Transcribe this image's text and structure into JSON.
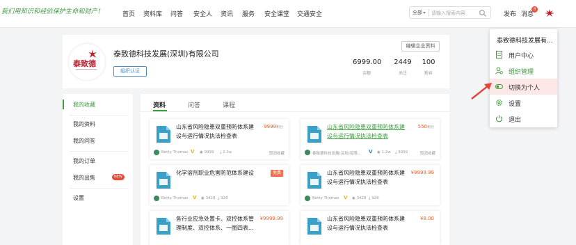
{
  "header": {
    "slogan": "我们用知识和经验保护生命和财产！",
    "nav": [
      "首页",
      "资料库",
      "问答",
      "安全人",
      "资讯",
      "服务",
      "安全课堂",
      "交通安全"
    ],
    "search": {
      "scope": "全部",
      "placeholder": "请输入搜索内容"
    },
    "publish_label": "发布",
    "messages_label": "消息",
    "messages_count": "8"
  },
  "profile": {
    "logo_text": "泰致德",
    "company_name": "泰致德科技发展(深圳)有限公司",
    "org_button": "组织认证",
    "edit_button": "编辑企业资料",
    "stats": [
      {
        "value": "6999.00",
        "label": "余额"
      },
      {
        "value": "2449",
        "label": "关注"
      },
      {
        "value": "100",
        "label": "粉丝"
      }
    ]
  },
  "sidebar": {
    "items": [
      {
        "label": "我的收藏",
        "active": true
      },
      {
        "label": "我的资料"
      },
      {
        "label": "我的问答"
      },
      {
        "label": "我的订单"
      },
      {
        "label": "我的出售",
        "badge": "NEW"
      },
      {
        "label": "设置"
      }
    ]
  },
  "tabs": [
    {
      "label": "资料",
      "active": true
    },
    {
      "label": "问答"
    },
    {
      "label": "课程"
    }
  ],
  "cards": [
    {
      "title": "山东省风险隐患双重预防体系建设与运行情况执法检查表",
      "price": "9999",
      "price_unit": "积分",
      "author": "Betty Thomas",
      "views": "9999",
      "downloads": "2.3w",
      "action": "取消收藏",
      "verify": "V",
      "verify_color": "#e8b41c"
    },
    {
      "title": "山东省风险隐患双重预防体系建设与运行情况执法检查表",
      "price": "550",
      "price_unit": "积分",
      "author": "泰致德科技发展(深圳)有限...",
      "views": "1.2w",
      "downloads": "9999",
      "action": "取消收藏",
      "link": true,
      "verify": "V",
      "verify_color": "#2a7fd0"
    },
    {
      "title": "化学溶剂职业危害防范体系建设",
      "free": "免费",
      "author": "Betty Thomas",
      "views": "3428",
      "downloads": "928",
      "verify": "V",
      "verify_color": "#e8b41c"
    },
    {
      "title": "山东省风险隐患双重预防体系建设与运行情况执法检查表",
      "price": "¥9999.99",
      "author": "Betty Thomas",
      "views": "3428",
      "downloads": "928",
      "verify": "V",
      "verify_color": "#e8b41c"
    },
    {
      "title": "各行业应急处置卡、双控体系管理制度、双控体系、一图四表...",
      "price": "¥9999.99"
    },
    {
      "title": "山东省风险隐患双重预防体系建设与运行情况执法检查表",
      "price": "¥8.00"
    }
  ],
  "user_menu": {
    "name": "泰致德科技发展有...",
    "items": [
      {
        "label": "用户中心",
        "icon": "document-icon"
      },
      {
        "label": "组织管理",
        "icon": "org-user-icon",
        "active": true
      },
      {
        "label": "切换为个人",
        "icon": "switch-icon",
        "hover": true
      },
      {
        "label": "设置",
        "icon": "gear-icon"
      },
      {
        "label": "退出",
        "icon": "power-icon"
      }
    ]
  },
  "colors": {
    "brand_green": "#3f9b3f",
    "price_orange": "#e8622c",
    "badge_red": "#e84c3d",
    "hover_pink": "#fde8e8"
  }
}
